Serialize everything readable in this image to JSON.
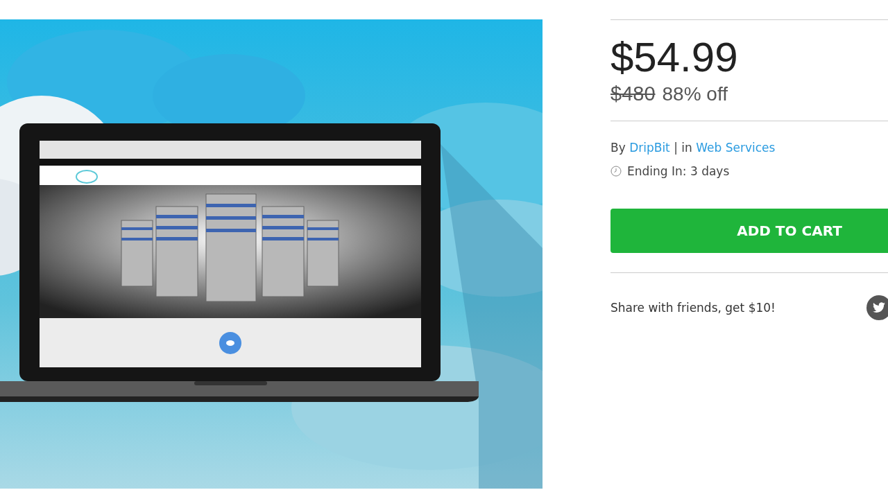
{
  "product": {
    "price": "$54.99",
    "original_price": "$480",
    "discount": "88% off",
    "byline": {
      "by": "By",
      "vendor": "DripBit",
      "separator": "|",
      "in": "in",
      "category": "Web Services"
    },
    "ending": "Ending In: 3 days",
    "add_to_cart": "ADD TO CART",
    "share": "Share with friends, get $10!"
  }
}
